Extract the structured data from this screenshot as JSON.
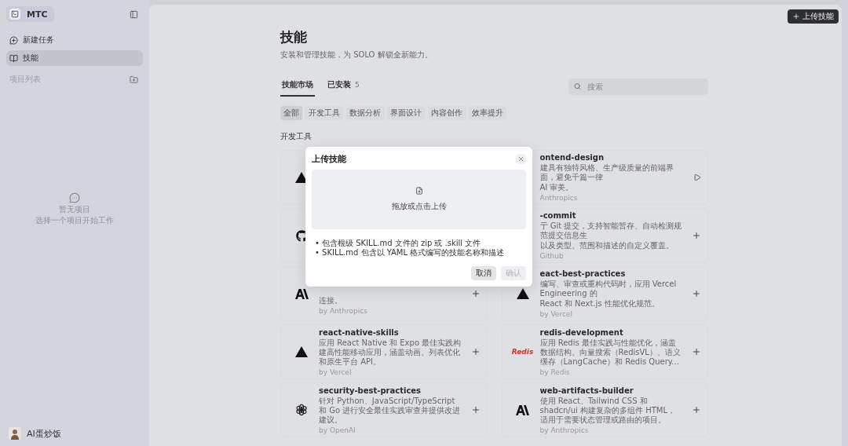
{
  "sidebar": {
    "brand": "MTC",
    "nav": [
      {
        "label": "新建任务",
        "selected": false
      },
      {
        "label": "技能",
        "selected": true
      }
    ],
    "section": "项目列表",
    "empty": {
      "title": "暂无项目",
      "hint": "选择一个项目开始工作"
    },
    "user": "AI蛋炒饭"
  },
  "header_button": "上传技能",
  "title": "技能",
  "subtitle": "安装和管理技能，为 SOLO 解锁全新能力。",
  "tabs": [
    {
      "label": "技能市场",
      "selected": true
    },
    {
      "label": "已安装",
      "count": "5",
      "selected": false
    }
  ],
  "search": {
    "placeholder": "搜索"
  },
  "filters": [
    {
      "label": "全部",
      "selected": true
    },
    {
      "label": "开发工具",
      "selected": false
    },
    {
      "label": "数据分析",
      "selected": false
    },
    {
      "label": "界面设计",
      "selected": false
    },
    {
      "label": "内容创作",
      "selected": false
    },
    {
      "label": "效率提升",
      "selected": false
    }
  ],
  "section": "开发工具",
  "cards": [
    {
      "kind": "triangle"
    },
    {
      "kind": "none",
      "name": "ontend-design",
      "lines": [
        "建具有独特风格、生产级质量的前端界面，避免千篇一律",
        "AI 审美。"
      ],
      "by": "Anthropics"
    },
    {
      "kind": "cat"
    },
    {
      "kind": "none",
      "name": "-commit",
      "lines": [
        "亍 Git 提交，支持智能暂存、自动检测规范提交信息生",
        "以及类型、范围和描述的自定义覆盖。"
      ],
      "by": "Github"
    },
    {
      "kind": "slash",
      "lines": [
        "连接。"
      ],
      "by": "by Anthropics"
    },
    {
      "kind": "triangle",
      "name": "eact-best-practices",
      "lines": [
        "编写、审查或重构代码时，应用 Vercel Engineering 的",
        "React 和 Next.js 性能优化规范。"
      ],
      "by": "by Vercel"
    },
    {
      "kind": "triangle",
      "name": "react-native-skills",
      "lines": [
        "应用 React Native 和 Expo 最佳实践构建高性能移动应用，涵盖动画、列表优化和原生平台 API。"
      ],
      "by": "by Vercel"
    },
    {
      "kind": "wordmark",
      "logo_text": "Redis",
      "name": "redis-development",
      "lines": [
        "应用 Redis 最佳实践与性能优化，涵盖数据结构、向量搜索（RedisVL）、语义缓存（LangCache）和 Redis Query..."
      ],
      "by": "by Redis"
    },
    {
      "kind": "knot",
      "name": "security-best-practices",
      "lines": [
        "针对 Python、JavaScript/TypeScript 和 Go 进行安全最佳实践审查并提供改进建议。"
      ],
      "by": "by OpenAI"
    },
    {
      "kind": "slash",
      "name": "web-artifacts-builder",
      "lines": [
        "使用 React、Tailwind CSS 和 shadcn/ui 构建复杂的多组件 HTML，适用于需要状态管理或路由的项目。"
      ],
      "by": "by Anthropics"
    }
  ],
  "modal": {
    "title": "上传技能",
    "drop_text": "拖放或点击上传",
    "bullets": [
      "• 包含根级 SKILL.md 文件的 zip 或 .skill 文件",
      "• SKILL.md 包含以 YAML 格式编写的技能名称和描述"
    ],
    "buttons": [
      {
        "label": "取消",
        "disabled": false
      },
      {
        "label": "确认",
        "disabled": true
      }
    ]
  }
}
